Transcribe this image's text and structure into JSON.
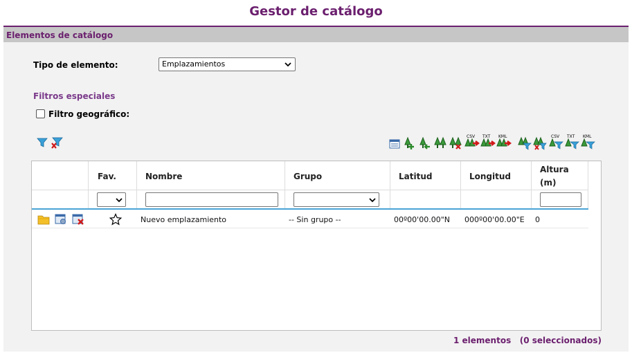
{
  "page": {
    "title": "Gestor de catálogo"
  },
  "panel": {
    "header": "Elementos de catálogo"
  },
  "form": {
    "tipo_label": "Tipo de elemento:",
    "tipo_value": "Emplazamientos",
    "filtros_title": "Filtros especiales",
    "geo_label": "Filtro geográfico:"
  },
  "table": {
    "columns": [
      "Fav.",
      "Nombre",
      "Grupo",
      "Latitud",
      "Longitud",
      "Altura (m)"
    ],
    "altura_line1": "Altura",
    "altura_line2": "(m)",
    "rows": [
      {
        "nombre": "Nuevo emplazamiento",
        "grupo": "-- Sin grupo --",
        "latitud": "00º00'00.00\"N",
        "longitud": "000º00'00.00\"E",
        "altura": "0"
      }
    ]
  },
  "toolbar": {
    "small_labels": {
      "csv": "CSV",
      "txt": "TXT",
      "kml": "KML"
    }
  },
  "footer": {
    "count": "1 elementos   (0 seleccionados)"
  },
  "colors": {
    "brand": "#6b1f6e",
    "accent": "#4aa3d6",
    "header_bg": "#c6c6c6"
  }
}
